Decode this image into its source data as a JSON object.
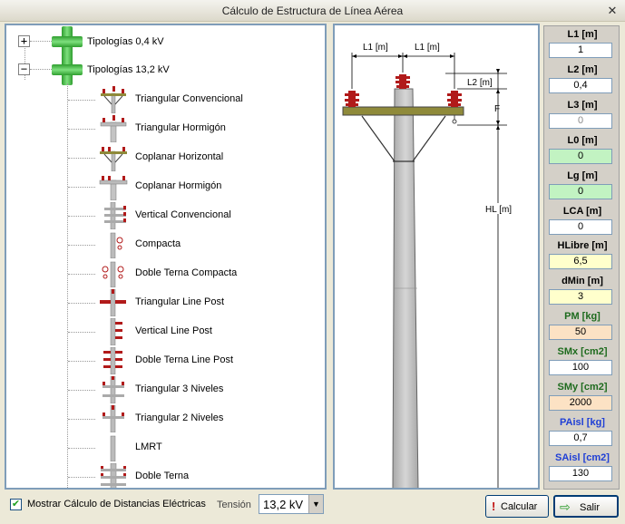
{
  "window": {
    "title": "Cálculo de Estructura de Línea Aérea"
  },
  "tree": {
    "groups": [
      {
        "label": "Tipologías 0,4 kV",
        "expander": "+"
      },
      {
        "label": "Tipologías 13,2 kV",
        "expander": "−"
      }
    ],
    "items": [
      {
        "label": "Triangular Convencional"
      },
      {
        "label": "Triangular Hormigón"
      },
      {
        "label": "Coplanar Horizontal"
      },
      {
        "label": "Coplanar Hormigón"
      },
      {
        "label": "Vertical Convencional"
      },
      {
        "label": "Compacta"
      },
      {
        "label": "Doble Terna Compacta"
      },
      {
        "label": "Triangular Line Post"
      },
      {
        "label": "Vertical Line Post"
      },
      {
        "label": "Doble Terna Line Post"
      },
      {
        "label": "Triangular 3 Niveles"
      },
      {
        "label": "Triangular 2 Niveles"
      },
      {
        "label": "LMRT"
      },
      {
        "label": "Doble Terna"
      }
    ]
  },
  "drawing": {
    "l1_left": "L1 [m]",
    "l1_right": "L1 [m]",
    "l2": "L2 [m]",
    "f": "F",
    "hl": "HL [m]"
  },
  "params": [
    {
      "label": "L1 [m]",
      "value": "1",
      "label_color": "#000000",
      "bg": "#ffffff",
      "text_color": "#000000"
    },
    {
      "label": "L2 [m]",
      "value": "0,4",
      "label_color": "#000000",
      "bg": "#ffffff",
      "text_color": "#000000"
    },
    {
      "label": "L3 [m]",
      "value": "0",
      "label_color": "#000000",
      "bg": "#ffffff",
      "text_color": "#8a8a8a"
    },
    {
      "label": "L0 [m]",
      "value": "0",
      "label_color": "#000000",
      "bg": "#c2f3c2",
      "text_color": "#000000"
    },
    {
      "label": "Lg [m]",
      "value": "0",
      "label_color": "#000000",
      "bg": "#c2f3c2",
      "text_color": "#000000"
    },
    {
      "label": "LCA [m]",
      "value": "0",
      "label_color": "#000000",
      "bg": "#ffffff",
      "text_color": "#000000"
    },
    {
      "label": "HLibre [m]",
      "value": "6,5",
      "label_color": "#000000",
      "bg": "#ffffcc",
      "text_color": "#000000"
    },
    {
      "label": "dMin [m]",
      "value": "3",
      "label_color": "#000000",
      "bg": "#ffffcc",
      "text_color": "#000000"
    },
    {
      "label": "PM [kg]",
      "value": "50",
      "label_color": "#1e6b1e",
      "bg": "#fce2c4",
      "text_color": "#000000"
    },
    {
      "label": "SMx [cm2]",
      "value": "100",
      "label_color": "#1e6b1e",
      "bg": "#ffffff",
      "text_color": "#000000"
    },
    {
      "label": "SMy [cm2]",
      "value": "2000",
      "label_color": "#1e6b1e",
      "bg": "#fce2c4",
      "text_color": "#000000"
    },
    {
      "label": "PAisl [kg]",
      "value": "0,7",
      "label_color": "#1f3fd6",
      "bg": "#ffffff",
      "text_color": "#000000"
    },
    {
      "label": "SAisl [cm2]",
      "value": "130",
      "label_color": "#1f3fd6",
      "bg": "#ffffff",
      "text_color": "#000000"
    }
  ],
  "bottom": {
    "checkbox_label": "Mostrar Cálculo de Distancias Eléctricas",
    "checked": true,
    "tension_label": "Tensión",
    "tension_value": "13,2 kV",
    "calc_label": "Calcular",
    "exit_label": "Salir"
  },
  "colors": {
    "accent_border": "#7f9db9",
    "insulator_red": "#b11a1a",
    "crossarm": "#8f8a3a"
  },
  "icons": {
    "tree_group": "green-cross-icon",
    "calc": "exclamation-icon",
    "exit": "arrow-right-icon",
    "close": "close-icon"
  }
}
